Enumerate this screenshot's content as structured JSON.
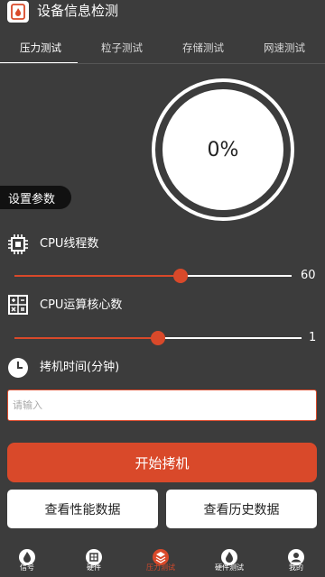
{
  "app": {
    "title": "设备信息检测"
  },
  "tabs": [
    {
      "label": "压力测试",
      "active": true
    },
    {
      "label": "粒子测试",
      "active": false
    },
    {
      "label": "存储测试",
      "active": false
    },
    {
      "label": "网速测试",
      "active": false
    }
  ],
  "gauge": {
    "value": "0%"
  },
  "settings": {
    "label": "设置参数"
  },
  "cpu_threads": {
    "label": "CPU线程数",
    "value": "60",
    "level": 0.6,
    "icon": "cpu-chip-icon"
  },
  "cpu_cores": {
    "label": "CPU运算核心数",
    "value": "1",
    "level": 0.5,
    "icon": "calculator-icon"
  },
  "burn_time": {
    "label": "拷机时间(分钟)",
    "placeholder": "请输入",
    "value": "",
    "icon": "clock-icon"
  },
  "buttons": {
    "start": "开始拷机",
    "performance": "查看性能数据",
    "history": "查看历史数据"
  },
  "nav": [
    {
      "label": "信号",
      "icon": "signal-icon",
      "active": false
    },
    {
      "label": "硬件",
      "icon": "chip-icon",
      "active": false
    },
    {
      "label": "压力测试",
      "icon": "stack-icon",
      "active": true
    },
    {
      "label": "硬件测试",
      "icon": "flame-icon",
      "active": false
    },
    {
      "label": "我的",
      "icon": "profile-icon",
      "active": false
    }
  ],
  "colors": {
    "accent": "#d9492a",
    "background": "#3c3c3c",
    "pill": "#111111"
  }
}
